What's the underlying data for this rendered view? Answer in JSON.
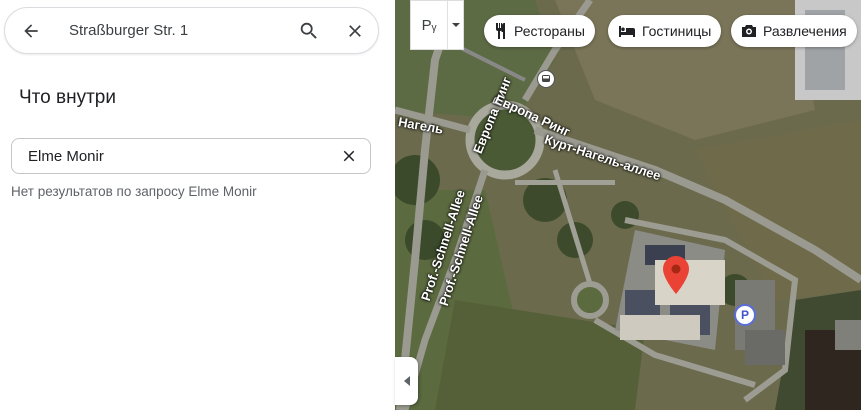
{
  "search": {
    "query": "Straßburger Str. 1",
    "back_icon": "arrow-left-icon",
    "search_icon": "search-icon",
    "close_icon": "close-icon"
  },
  "panel": {
    "title": "Что внутри",
    "filter_value": "Elme Monir",
    "no_results": "Нет результатов по запросу Elme Monir"
  },
  "map": {
    "layer_label": "Pᵧ",
    "chips": [
      {
        "label": "Рестораны",
        "icon": "fork-knife-icon"
      },
      {
        "label": "Гостиницы",
        "icon": "bed-icon"
      },
      {
        "label": "Развлечения",
        "icon": "camera-icon"
      }
    ],
    "streets": {
      "kurt_nagel": "Курт-Нагель-аллее",
      "europa_ring": "Европа Ринг",
      "europa_ring_top": "Европа Ринг",
      "schnell_1": "Prof.-Schnell-Allee",
      "schnell_2": "Prof.-Schnell-Allee",
      "nagel_left": "Нагель"
    },
    "parking_label": "P",
    "colors": {
      "pin": "#ea4335",
      "parking_border": "#5b6dd8"
    }
  }
}
